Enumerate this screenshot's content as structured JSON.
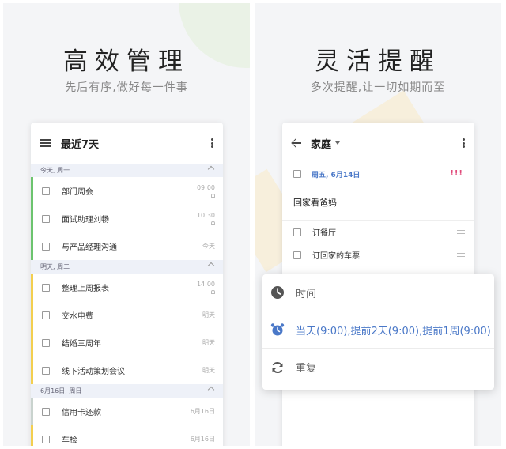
{
  "left": {
    "headline": "高效管理",
    "subline": "先后有序,做好每一件事",
    "app_title": "最近7天",
    "sections": [
      {
        "header": "今天, 周一",
        "tasks": [
          {
            "label": "部门周会",
            "time": "09:00",
            "bell": true,
            "color": "green"
          },
          {
            "label": "面试助理刘畅",
            "time": "10:30",
            "bell": true,
            "color": "green"
          },
          {
            "label": "与产品经理沟通",
            "time": "今天",
            "bell": false,
            "color": "green"
          }
        ]
      },
      {
        "header": "明天, 周二",
        "tasks": [
          {
            "label": "整理上周报表",
            "time": "14:00",
            "bell": true,
            "color": "yellow"
          },
          {
            "label": "交水电费",
            "time": "明天",
            "bell": false,
            "color": "yellow"
          },
          {
            "label": "结婚三周年",
            "time": "明天",
            "bell": false,
            "color": "yellow"
          },
          {
            "label": "线下活动策划会议",
            "time": "明天",
            "bell": false,
            "color": "yellow"
          }
        ]
      },
      {
        "header": "6月16日, 周日",
        "tasks": [
          {
            "label": "信用卡还款",
            "time": "6月16日",
            "bell": false,
            "color": "none"
          },
          {
            "label": "车检",
            "time": "6月16日",
            "bell": false,
            "color": "yellow"
          }
        ]
      }
    ]
  },
  "right": {
    "headline": "灵活提醒",
    "subline": "多次提醒,让一切如期而至",
    "app_title": "家庭",
    "due_date": "周五, 6月14日",
    "priority": "!!!",
    "task_title": "回家看爸妈",
    "sub_items": [
      "订餐厅",
      "订回家的车票"
    ],
    "popup": {
      "time_label": "时间",
      "reminder_label": "当天(9:00),提前2天(9:00),提前1周(9:00)",
      "repeat_label": "重复"
    }
  },
  "colors": {
    "accent_blue": "#4a78c8",
    "green": "#6cc46e",
    "yellow": "#f3cf4f",
    "priority_pink": "#e04a7a"
  }
}
